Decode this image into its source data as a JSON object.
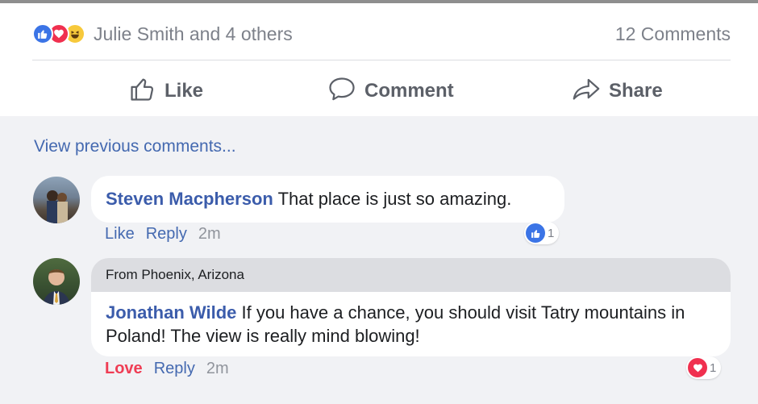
{
  "post": {
    "reactors": "Julie Smith and 4 others",
    "comment_count": "12 Comments",
    "reaction_icons": [
      "like-icon",
      "love-icon",
      "haha-icon"
    ],
    "colors": {
      "like": "#3b74e6",
      "love": "#f0304f",
      "haha": "#f7c93b",
      "link": "#4469b0",
      "author": "#3b5cab"
    }
  },
  "actions": {
    "like": "Like",
    "comment": "Comment",
    "share": "Share"
  },
  "comments": {
    "view_previous": "View previous comments...",
    "items": [
      {
        "author": "Steven Macpherson",
        "text": "That place is just so amazing.",
        "like_label": "Like",
        "reply_label": "Reply",
        "time": "2m",
        "reaction_icon": "like-icon",
        "reaction_count": "1"
      },
      {
        "header": "From Phoenix, Arizona",
        "author": "Jonathan Wilde",
        "text": "If you have a chance, you should visit Tatry mountains in Poland! The view is really mind blowing!",
        "like_label": "Love",
        "reply_label": "Reply",
        "time": "2m",
        "reaction_icon": "love-icon",
        "reaction_count": "1"
      }
    ]
  }
}
